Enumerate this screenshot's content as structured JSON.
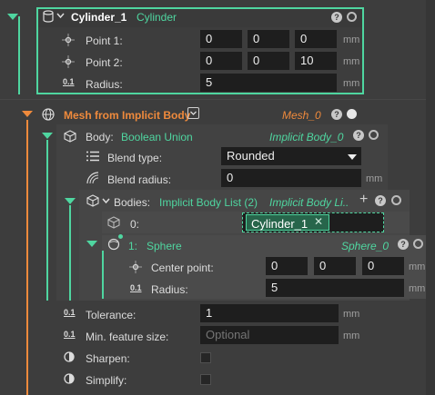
{
  "cylinder": {
    "name": "Cylinder_1",
    "type": "Cylinder",
    "fields": [
      {
        "label": "Point 1:",
        "values": [
          "0",
          "0",
          "0"
        ],
        "unit": "mm"
      },
      {
        "label": "Point 2:",
        "values": [
          "0",
          "0",
          "10"
        ],
        "unit": "mm"
      },
      {
        "label": "Radius:",
        "values": [
          "5"
        ],
        "unit": "mm"
      }
    ]
  },
  "mesh": {
    "title": "Mesh from Implicit Body",
    "output": "Mesh_0",
    "body": {
      "label": "Body:",
      "value": "Boolean Union",
      "output": "Implicit Body_0",
      "blend_type": {
        "label": "Blend type:",
        "value": "Rounded"
      },
      "blend_radius": {
        "label": "Blend radius:",
        "value": "0",
        "unit": "mm"
      },
      "bodies": {
        "label": "Bodies:",
        "value": "Implicit Body List (2)",
        "output": "Implicit Body Li...",
        "item0": {
          "index": "0:",
          "tag": "Cylinder_1",
          "remove": "✕"
        },
        "sphere": {
          "index": "1:",
          "name": "Sphere",
          "output": "Sphere_0",
          "center": {
            "label": "Center point:",
            "values": [
              "0",
              "0",
              "0"
            ],
            "unit": "mm"
          },
          "radius": {
            "label": "Radius:",
            "value": "5",
            "unit": "mm"
          }
        }
      }
    },
    "tolerance": {
      "label": "Tolerance:",
      "value": "1",
      "unit": "mm"
    },
    "min_feature": {
      "label": "Min. feature size:",
      "placeholder": "Optional",
      "unit": "mm"
    },
    "sharpen": {
      "label": "Sharpen:",
      "checked": false
    },
    "simplify": {
      "label": "Simplify:",
      "checked": false
    }
  },
  "icons": {
    "help": "?",
    "scale": "0.1",
    "plus": "+"
  },
  "colors": {
    "accent_green": "#4fd6a0",
    "accent_orange": "#ef8a3c",
    "field_bg": "#1e1e1e",
    "panel_bg": "#3d3d3d"
  }
}
